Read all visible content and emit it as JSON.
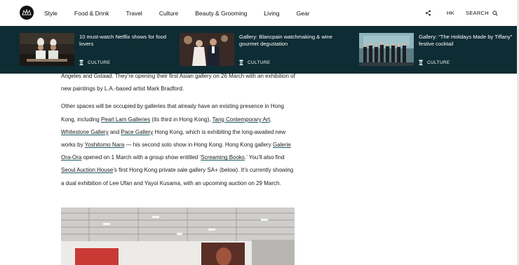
{
  "nav": {
    "items": [
      "Style",
      "Food & Drink",
      "Travel",
      "Culture",
      "Beauty & Grooming",
      "Living",
      "Gear"
    ],
    "region": "HK",
    "search_label": "SEARCH"
  },
  "featured": [
    {
      "title": "10 must-watch Netflix shows for food lovers",
      "category": "CULTURE"
    },
    {
      "title": "Gallery: Blancpain watchmaking & wine gourmet degustation",
      "category": "CULTURE"
    },
    {
      "title": "Gallery: “The Holidays Made by Tiffany” festive cocktail",
      "category": "CULTURE"
    }
  ],
  "article": {
    "p1": {
      "a": "Angeles and Gstaad. They’re opening their first Asian gallery on 26 March with an exhibition of new paintings by L.A.-based artist Mark Bradford."
    },
    "p2": {
      "t1": "Other spaces will be occupied by galleries that already have an existing presence in Hong Kong, including ",
      "l1": "Pearl Lam Galleries",
      "t2": " (its third in Hong Kong), ",
      "l2": "Tang Contemporary Art",
      "t3": ", ",
      "l3": "Whitestone Gallery",
      "t4": " and ",
      "l4": "Pace Gallery",
      "t5": " Hong Kong, which is exhibiting the long-awaited new works by ",
      "l5": "Yoshitomo Nara",
      "t6": " — his second solo show in Hong Kong. Hong Kong gallery ",
      "l6": "Galerie Ora-Ora",
      "t7": " opened on 1 March with a group show entitled ‘",
      "l7": "Screaming Books",
      "t8": ".’ You’ll also find ",
      "l8": "Seoul Auction House",
      "t9": "’s first Hong Kong private sale gallery SA+ (below). It’s currently showing a dual exhibition of Lee Ufan and Yayoi Kusama, with an upcoming auction on 29 March."
    }
  },
  "colors": {
    "strip_bg": "#0e2c33",
    "link_underline": "#1c5e6a",
    "text": "#1a1a1a"
  },
  "icons": [
    "logo-icon",
    "share-icon",
    "search-icon",
    "culture-category-icon"
  ]
}
